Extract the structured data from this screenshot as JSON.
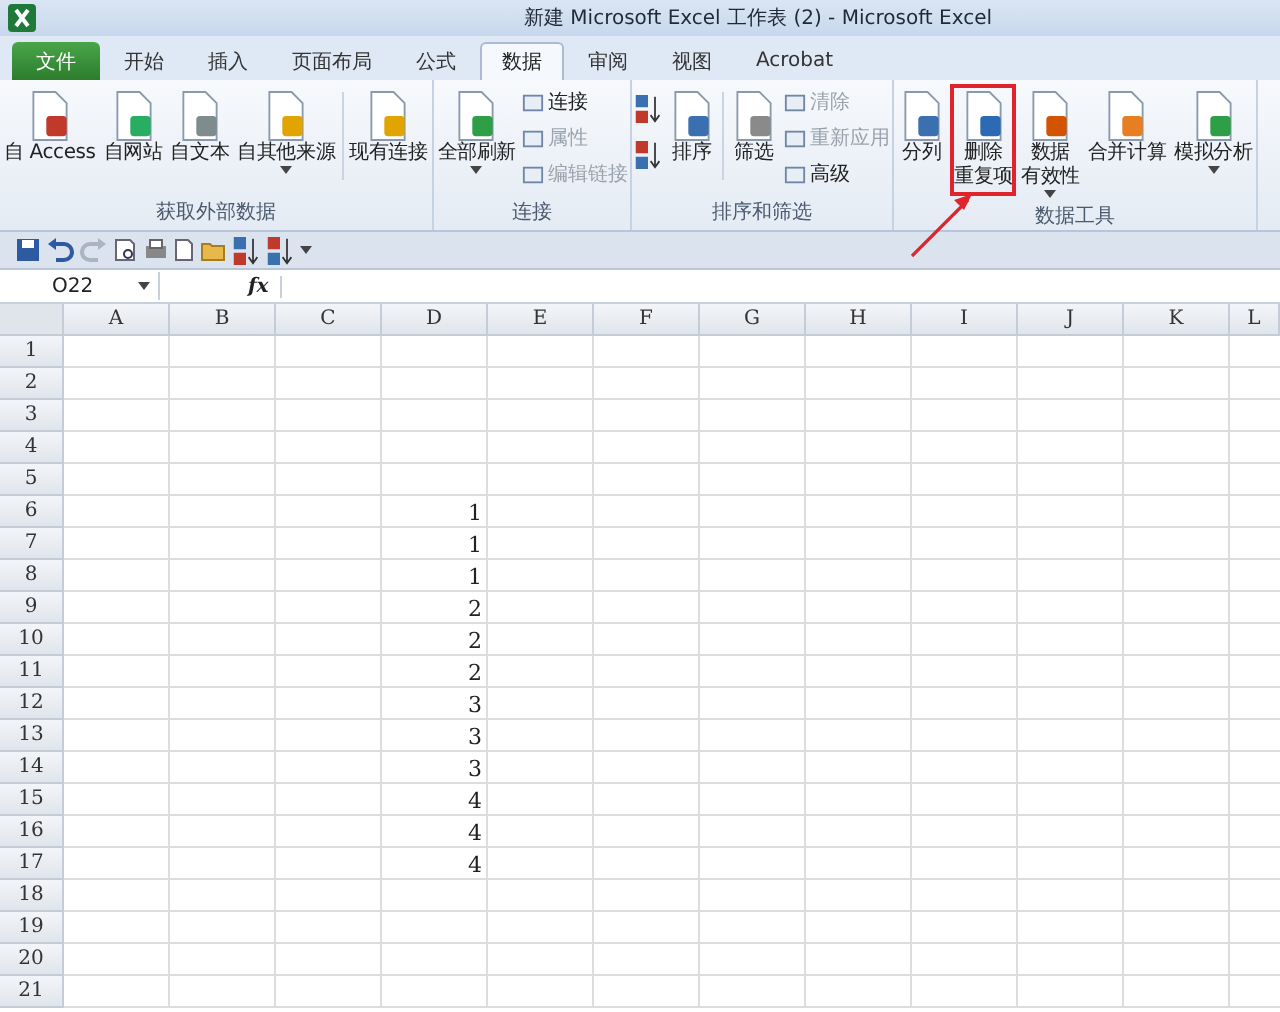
{
  "window": {
    "title": "新建 Microsoft Excel 工作表 (2) - Microsoft Excel"
  },
  "tabs": [
    {
      "label": "文件",
      "kind": "file",
      "selected": false
    },
    {
      "label": "开始",
      "kind": "normal",
      "selected": false
    },
    {
      "label": "插入",
      "kind": "normal",
      "selected": false
    },
    {
      "label": "页面布局",
      "kind": "normal",
      "selected": false
    },
    {
      "label": "公式",
      "kind": "normal",
      "selected": false
    },
    {
      "label": "数据",
      "kind": "normal",
      "selected": true
    },
    {
      "label": "审阅",
      "kind": "normal",
      "selected": false
    },
    {
      "label": "视图",
      "kind": "normal",
      "selected": false
    },
    {
      "label": "Acrobat",
      "kind": "normal",
      "selected": false
    }
  ],
  "ribbon": {
    "groups": [
      {
        "label": "获取外部数据",
        "items": [
          {
            "kind": "large",
            "lines": [
              "自 Access"
            ],
            "dropdown": false,
            "disabled": false,
            "highlighted": false
          },
          {
            "kind": "large",
            "lines": [
              "自网站"
            ],
            "dropdown": false,
            "disabled": false,
            "highlighted": false
          },
          {
            "kind": "large",
            "lines": [
              "自文本"
            ],
            "dropdown": false,
            "disabled": false,
            "highlighted": false
          },
          {
            "kind": "large",
            "lines": [
              "自其他来源"
            ],
            "dropdown": true,
            "disabled": false,
            "highlighted": false
          },
          {
            "kind": "separator"
          },
          {
            "kind": "large",
            "lines": [
              "现有连接"
            ],
            "dropdown": false,
            "disabled": false,
            "highlighted": false
          }
        ]
      },
      {
        "label": "连接",
        "items": [
          {
            "kind": "large",
            "lines": [
              "全部刷新"
            ],
            "dropdown": true,
            "disabled": false,
            "highlighted": false
          },
          {
            "kind": "stack",
            "entries": [
              {
                "label": "连接",
                "disabled": false
              },
              {
                "label": "属性",
                "disabled": true
              },
              {
                "label": "编辑链接",
                "disabled": true
              }
            ]
          }
        ]
      },
      {
        "label": "排序和筛选",
        "items": [
          {
            "kind": "sortstack"
          },
          {
            "kind": "large",
            "lines": [
              "排序"
            ],
            "dropdown": false,
            "disabled": false,
            "highlighted": false
          },
          {
            "kind": "separator"
          },
          {
            "kind": "large",
            "lines": [
              "筛选"
            ],
            "dropdown": false,
            "disabled": false,
            "highlighted": false
          },
          {
            "kind": "stack",
            "entries": [
              {
                "label": "清除",
                "disabled": true
              },
              {
                "label": "重新应用",
                "disabled": true
              },
              {
                "label": "高级",
                "disabled": false
              }
            ]
          }
        ]
      },
      {
        "label": "数据工具",
        "items": [
          {
            "kind": "large",
            "lines": [
              "分列"
            ],
            "dropdown": false,
            "disabled": false,
            "highlighted": false
          },
          {
            "kind": "large",
            "lines": [
              "删除",
              "重复项"
            ],
            "dropdown": false,
            "disabled": false,
            "highlighted": true
          },
          {
            "kind": "large",
            "lines": [
              "数据",
              "有效性"
            ],
            "dropdown": true,
            "disabled": false,
            "highlighted": false
          },
          {
            "kind": "large",
            "lines": [
              "合并计算"
            ],
            "dropdown": false,
            "disabled": false,
            "highlighted": false
          },
          {
            "kind": "large",
            "lines": [
              "模拟分析"
            ],
            "dropdown": true,
            "disabled": false,
            "highlighted": false
          }
        ]
      }
    ]
  },
  "formula_bar": {
    "name_box": "O22",
    "fx": "fx"
  },
  "columns": [
    "A",
    "B",
    "C",
    "D",
    "E",
    "F",
    "G",
    "H",
    "I",
    "J",
    "K",
    "L"
  ],
  "rows": [
    {
      "label": "1"
    },
    {
      "label": "2"
    },
    {
      "label": "3"
    },
    {
      "label": "4"
    },
    {
      "label": "5"
    },
    {
      "label": "6",
      "cells": [
        {
          "kind": "empty"
        },
        {
          "kind": "empty"
        },
        {
          "kind": "empty"
        },
        {
          "kind": "number",
          "value": "1"
        }
      ]
    },
    {
      "label": "7",
      "cells": [
        {
          "kind": "empty"
        },
        {
          "kind": "empty"
        },
        {
          "kind": "empty"
        },
        {
          "kind": "number",
          "value": "1"
        }
      ]
    },
    {
      "label": "8",
      "cells": [
        {
          "kind": "empty"
        },
        {
          "kind": "empty"
        },
        {
          "kind": "empty"
        },
        {
          "kind": "number",
          "value": "1"
        }
      ]
    },
    {
      "label": "9",
      "cells": [
        {
          "kind": "empty"
        },
        {
          "kind": "empty"
        },
        {
          "kind": "empty"
        },
        {
          "kind": "number",
          "value": "2"
        }
      ]
    },
    {
      "label": "10",
      "cells": [
        {
          "kind": "empty"
        },
        {
          "kind": "empty"
        },
        {
          "kind": "empty"
        },
        {
          "kind": "number",
          "value": "2"
        }
      ]
    },
    {
      "label": "11",
      "cells": [
        {
          "kind": "empty"
        },
        {
          "kind": "empty"
        },
        {
          "kind": "empty"
        },
        {
          "kind": "number",
          "value": "2"
        }
      ]
    },
    {
      "label": "12",
      "cells": [
        {
          "kind": "empty"
        },
        {
          "kind": "empty"
        },
        {
          "kind": "empty"
        },
        {
          "kind": "number",
          "value": "3"
        }
      ]
    },
    {
      "label": "13",
      "cells": [
        {
          "kind": "empty"
        },
        {
          "kind": "empty"
        },
        {
          "kind": "empty"
        },
        {
          "kind": "number",
          "value": "3"
        }
      ]
    },
    {
      "label": "14",
      "cells": [
        {
          "kind": "empty"
        },
        {
          "kind": "empty"
        },
        {
          "kind": "empty"
        },
        {
          "kind": "number",
          "value": "3"
        }
      ]
    },
    {
      "label": "15",
      "cells": [
        {
          "kind": "empty"
        },
        {
          "kind": "empty"
        },
        {
          "kind": "empty"
        },
        {
          "kind": "number",
          "value": "4"
        }
      ]
    },
    {
      "label": "16",
      "cells": [
        {
          "kind": "empty"
        },
        {
          "kind": "empty"
        },
        {
          "kind": "empty"
        },
        {
          "kind": "number",
          "value": "4"
        }
      ]
    },
    {
      "label": "17",
      "cells": [
        {
          "kind": "empty"
        },
        {
          "kind": "empty"
        },
        {
          "kind": "empty"
        },
        {
          "kind": "number",
          "value": "4"
        }
      ]
    },
    {
      "label": "18"
    },
    {
      "label": "19"
    },
    {
      "label": "20"
    },
    {
      "label": "21"
    }
  ]
}
